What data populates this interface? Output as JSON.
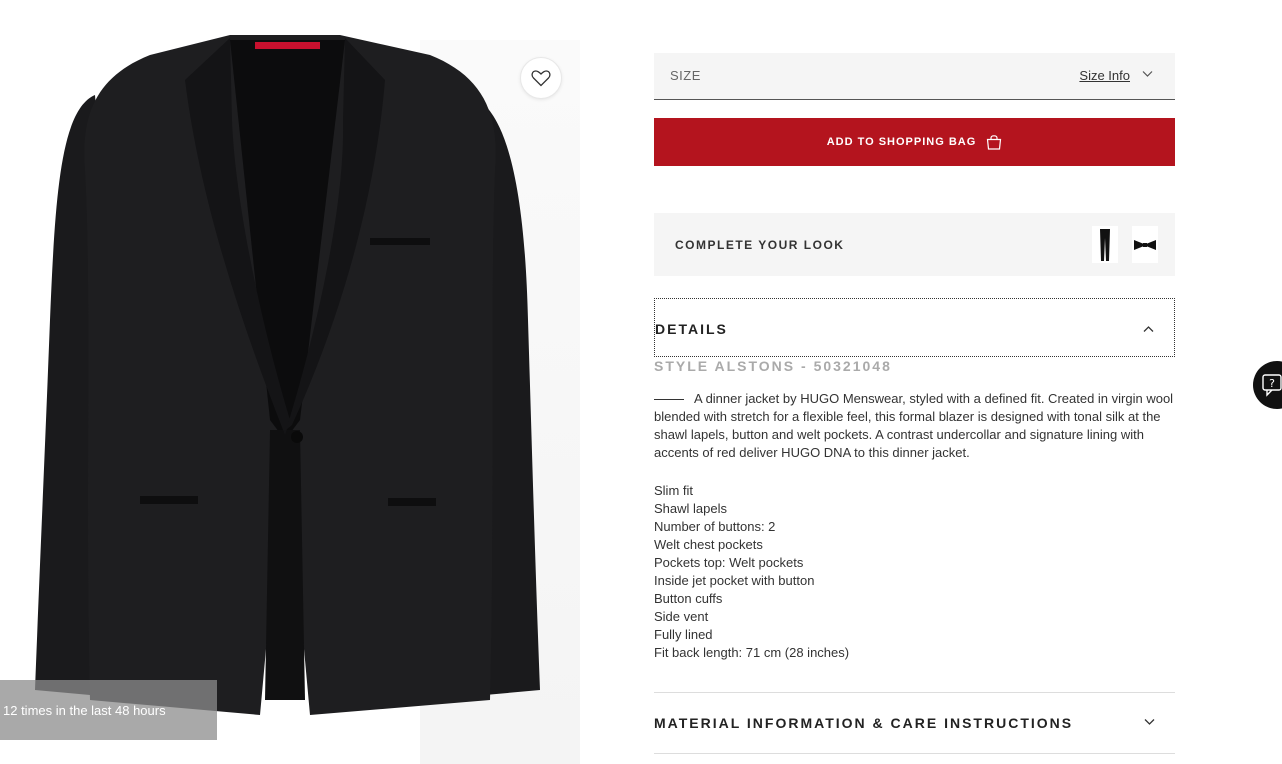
{
  "product": {
    "badge": "12 times in the last 48 hours"
  },
  "size": {
    "label": "SIZE",
    "info_link": "Size Info"
  },
  "cart": {
    "add_label": "ADD TO SHOPPING BAG"
  },
  "look": {
    "label": "COMPLETE YOUR LOOK",
    "items": [
      "trousers-thumb",
      "bow-tie-thumb"
    ]
  },
  "details": {
    "title": "DETAILS",
    "style": "STYLE ALSTONS - 50321048",
    "description": "A dinner jacket by HUGO Menswear, styled with a defined fit. Created in virgin wool blended with stretch for a flexible feel, this formal blazer is designed with tonal silk at the shawl lapels, button and welt pockets. A contrast undercollar and signature lining with accents of red deliver HUGO DNA to this dinner jacket.",
    "features": [
      "Slim fit",
      "Shawl lapels",
      "Number of buttons: 2",
      "Welt chest pockets",
      "Pockets top: Welt pockets",
      "Inside jet pocket with button",
      "Button cuffs",
      "Side vent",
      "Fully lined",
      "Fit back length: 71 cm (28 inches)"
    ]
  },
  "material": {
    "title": "MATERIAL INFORMATION & CARE INSTRUCTIONS"
  },
  "colors": {
    "accent": "#b4141e",
    "panel": "#f5f5f5"
  }
}
